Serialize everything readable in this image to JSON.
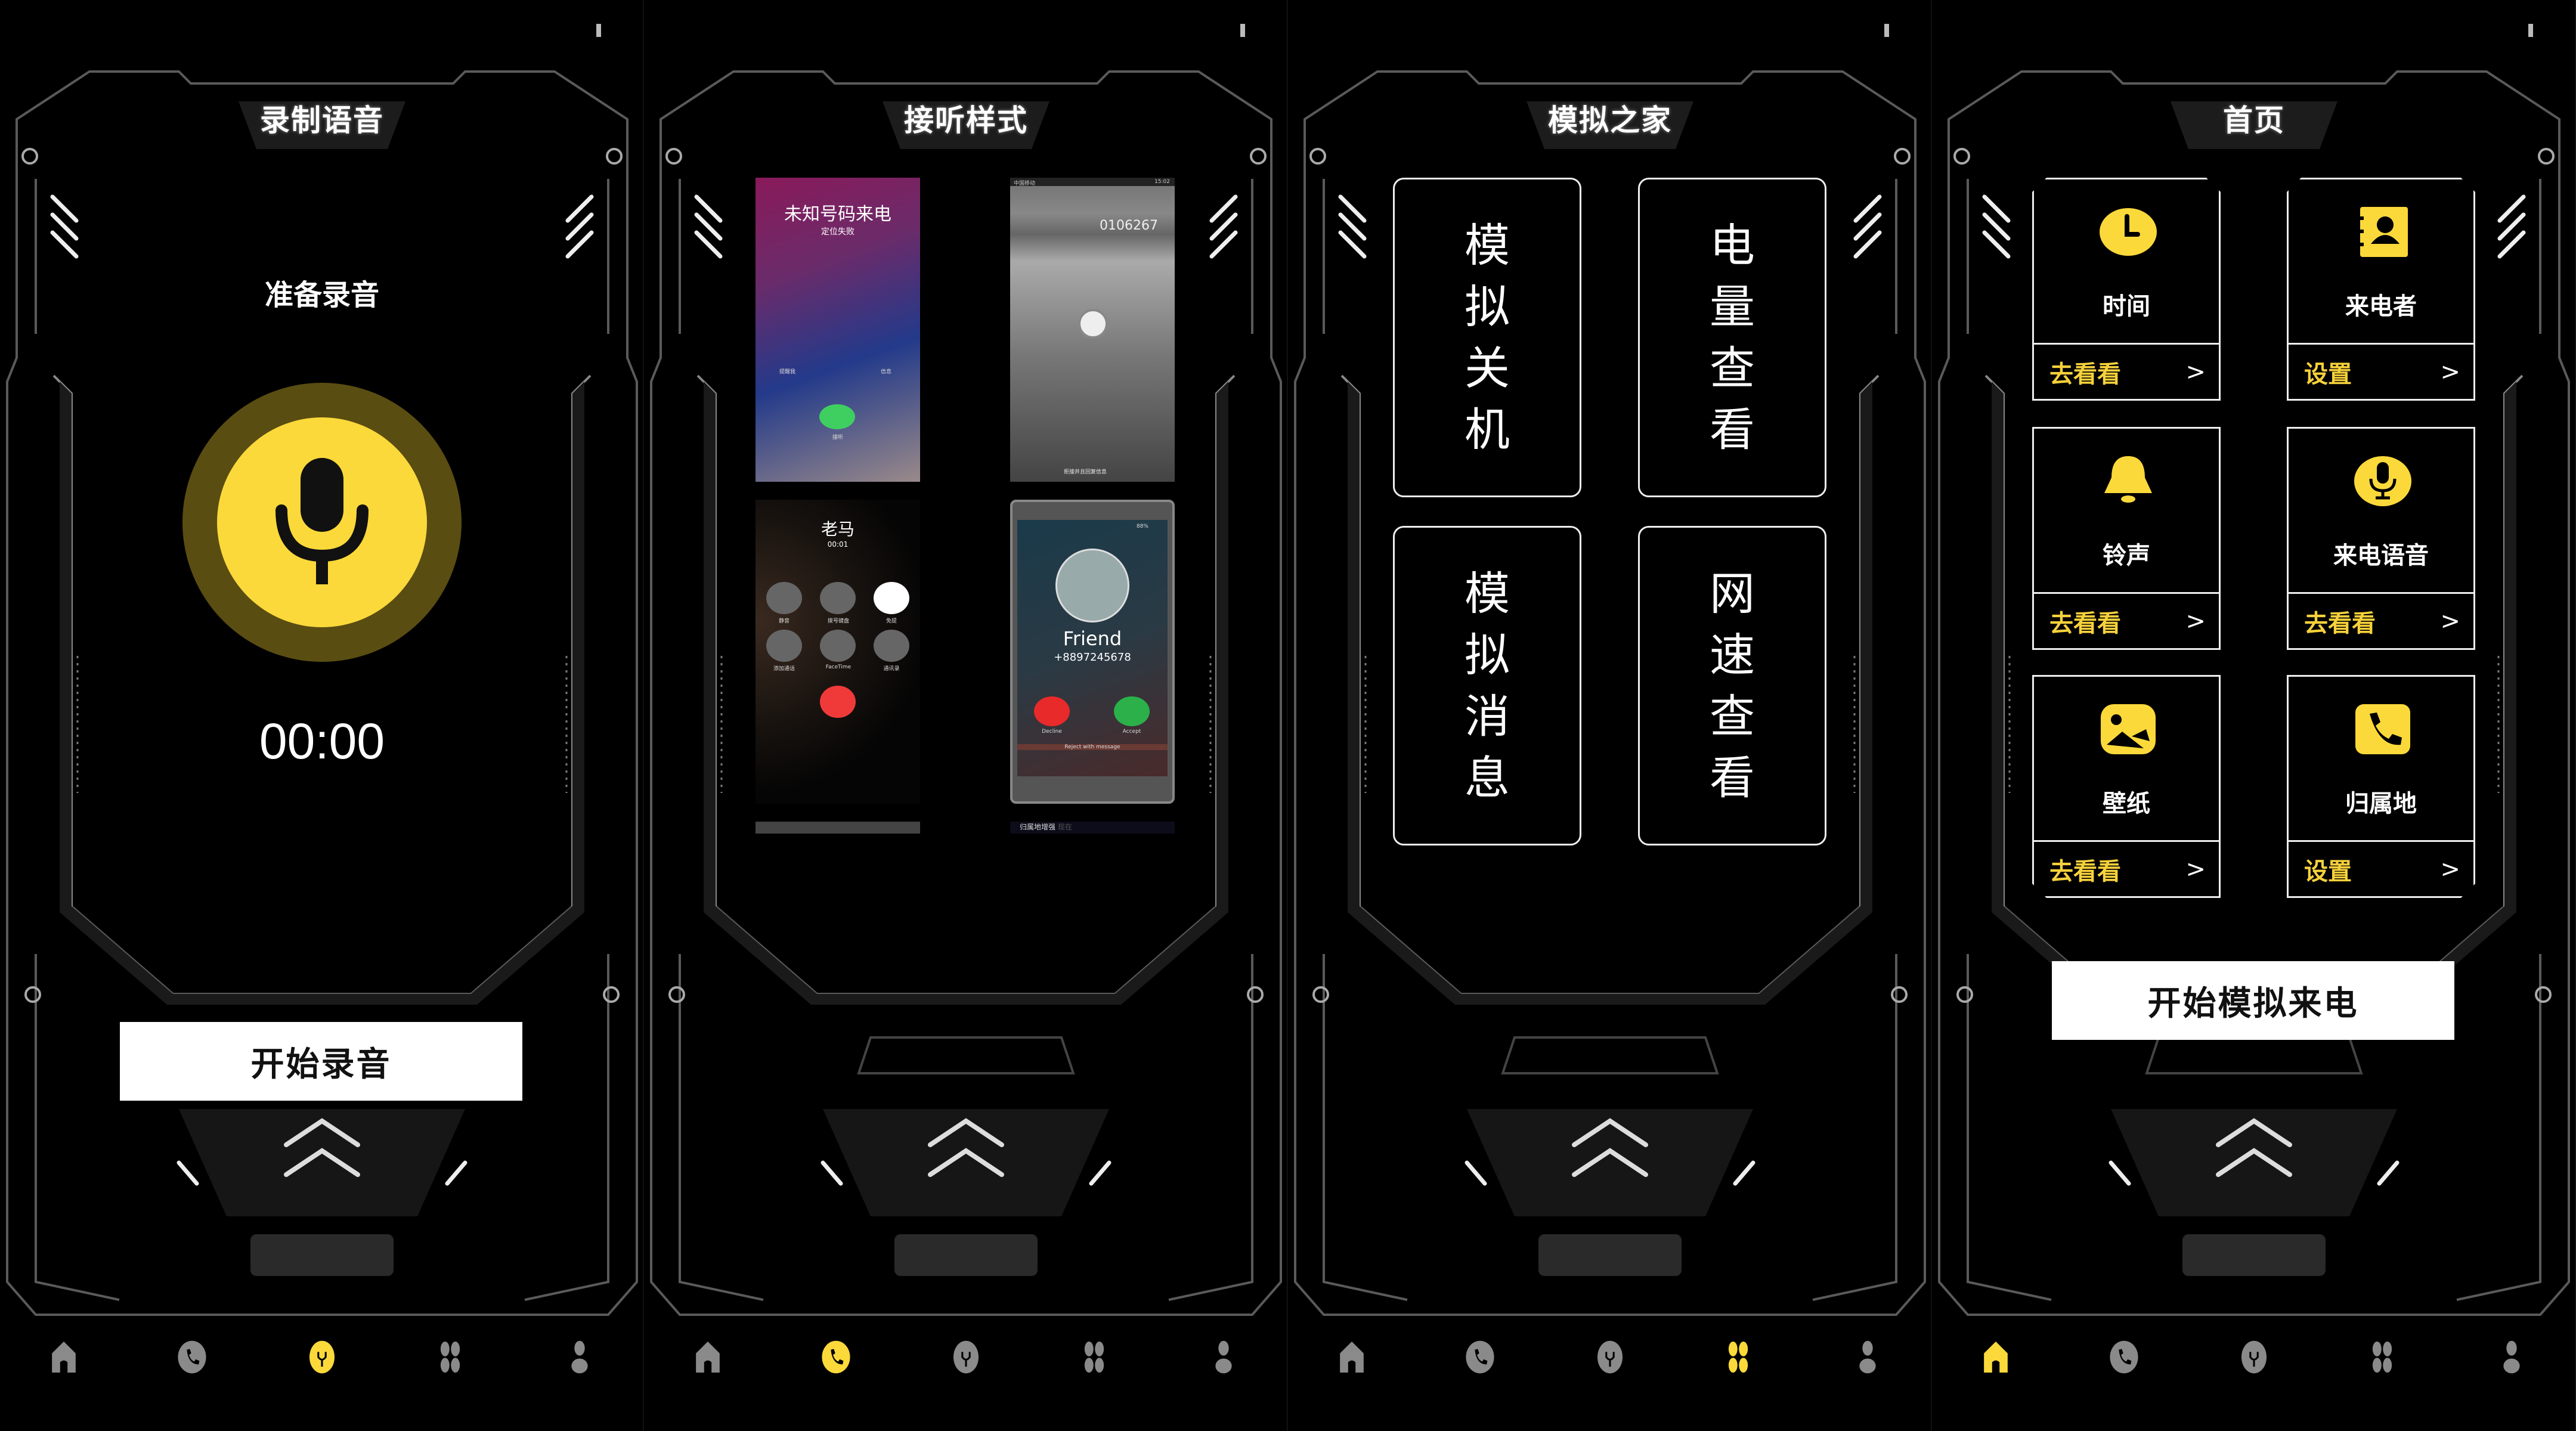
{
  "colors": {
    "accent": "#FBD93A",
    "nav_inactive": "#8a8a8a",
    "frame": "#5a5a5a"
  },
  "nav_icons": [
    "home-icon",
    "phone-icon",
    "mic-icon",
    "grid-icon",
    "person-icon"
  ],
  "panels": [
    {
      "title": "录制语音",
      "active_nav": 2,
      "status": "准备录音",
      "timer": "00:00",
      "button": "开始录音"
    },
    {
      "title": "接听样式",
      "active_nav": 1,
      "styles": [
        {
          "caller": "未知号码来电",
          "sub": "定位失败",
          "btn_left": "提醒我",
          "btn_right": "信息",
          "answer": "接听"
        },
        {
          "carrier": "中国移动",
          "time": "15:02",
          "number": "0106267",
          "reply": "拒接并且回复信息"
        },
        {
          "caller": "老马",
          "duration": "00:01",
          "buttons": [
            "静音",
            "拨号键盘",
            "免提",
            "添加通话",
            "FaceTime",
            "通讯录"
          ]
        },
        {
          "battery": "88%",
          "caller": "Friend",
          "number": "+8897245678",
          "decline": "Decline",
          "accept": "Accept",
          "reject": "Reject with message",
          "footer": "归属地增强",
          "footer_sub": "现在"
        }
      ]
    },
    {
      "title": "模拟之家",
      "active_nav": 3,
      "cards": [
        [
          "模",
          "拟",
          "关",
          "机"
        ],
        [
          "电",
          "量",
          "查",
          "看"
        ],
        [
          "模",
          "拟",
          "消",
          "息"
        ],
        [
          "网",
          "速",
          "查",
          "看"
        ]
      ]
    },
    {
      "title": "首页",
      "active_nav": 0,
      "cards": [
        {
          "icon": "clock-icon",
          "label": "时间",
          "action": "去看看"
        },
        {
          "icon": "contact-book-icon",
          "label": "来电者",
          "action": "设置"
        },
        {
          "icon": "bell-icon",
          "label": "铃声",
          "action": "去看看"
        },
        {
          "icon": "mic-icon",
          "label": "来电语音",
          "action": "去看看"
        },
        {
          "icon": "wallpaper-icon",
          "label": "壁纸",
          "action": "去看看"
        },
        {
          "icon": "phone-icon",
          "label": "归属地",
          "action": "设置"
        }
      ],
      "chevron": ">",
      "button": "开始模拟来电"
    }
  ]
}
